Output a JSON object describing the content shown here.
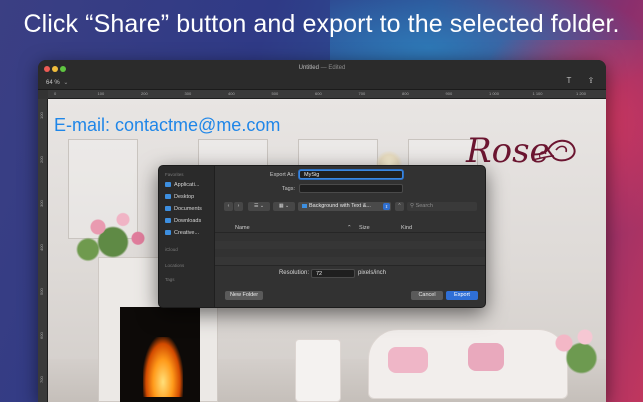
{
  "headline": "Click “Share” button and export to the selected folder.",
  "window": {
    "title": "Untitled",
    "title_separator": "—",
    "edited": "Edited",
    "zoom": "64 %",
    "zoom_chevron": "⌄",
    "toolbar": {
      "text_tool_glyph": "T",
      "share_glyph": "⇪"
    }
  },
  "ruler": {
    "top_ticks": [
      "0",
      "100",
      "200",
      "300",
      "400",
      "500",
      "600",
      "700",
      "800",
      "900",
      "1 000",
      "1 100",
      "1 200"
    ],
    "left_ticks": [
      "100",
      "200",
      "300",
      "400",
      "500",
      "600",
      "700"
    ]
  },
  "canvas": {
    "email_text": "E-mail: contactme@me.com",
    "logo_text": "Rose",
    "email_color": "#1f86e8",
    "logo_color": "#6b1530"
  },
  "dialog": {
    "sidebar": {
      "favorites_header": "Favorites",
      "items": [
        "Applicati...",
        "Desktop",
        "Documents",
        "Downloads",
        "Creative..."
      ],
      "icloud_header": "iCloud",
      "locations_header": "Locations",
      "tags_header": "Tags"
    },
    "export_as_label": "Export As:",
    "export_as_value": "MySig",
    "tags_label": "Tags:",
    "nav": {
      "back": "‹",
      "forward": "›",
      "list_view": "☰ ⌄",
      "grid_view": "▦ ⌄"
    },
    "location": "Background with Text &...",
    "location_arrow": "⇕",
    "up_glyph": "⌃",
    "search_placeholder": "Search",
    "columns": {
      "name": "Name",
      "sort_glyph": "⌃",
      "size": "Size",
      "kind": "Kind"
    },
    "resolution_label": "Resolution:",
    "resolution_value": "72",
    "resolution_unit": "pixels/inch",
    "new_folder": "New Folder",
    "cancel": "Cancel",
    "export": "Export",
    "accent": "#2f6fd6"
  }
}
